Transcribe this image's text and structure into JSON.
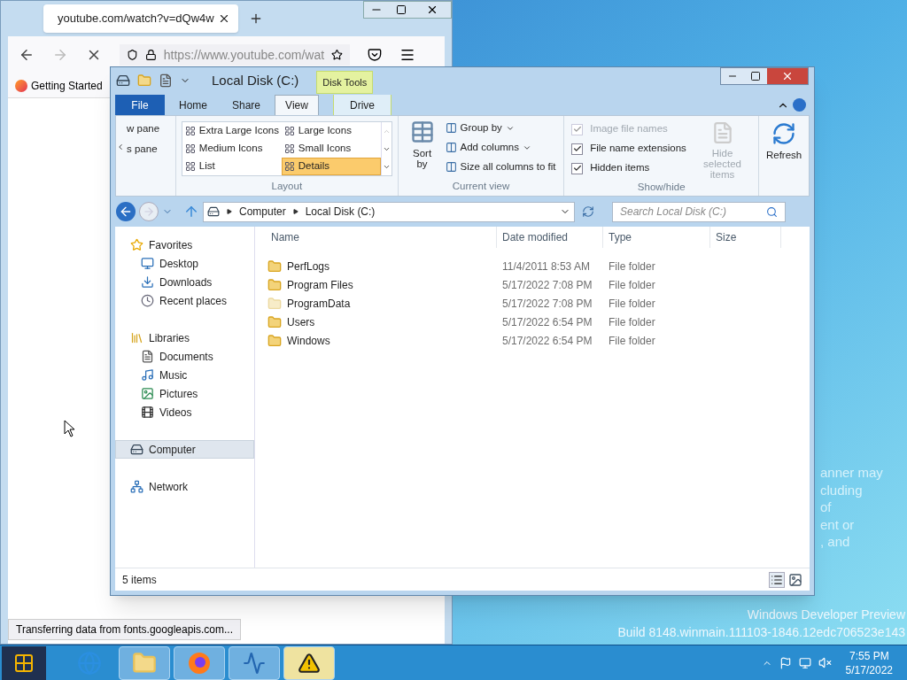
{
  "browser": {
    "tab_title": "youtube.com/watch?v=dQw4w",
    "url": "https://www.youtube.com/wat",
    "bookmark": "Getting Started",
    "status": "Transferring data from fonts.googleapis.com..."
  },
  "explorer": {
    "title": "Local Disk (C:)",
    "context_tab": "Disk Tools",
    "tabs": [
      {
        "label": "File",
        "kind": "file",
        "selected": false
      },
      {
        "label": "Home",
        "kind": "normal",
        "selected": false
      },
      {
        "label": "Share",
        "kind": "normal",
        "selected": false
      },
      {
        "label": "View",
        "kind": "normal",
        "selected": true
      },
      {
        "label": "Drive",
        "kind": "context",
        "selected": false
      }
    ],
    "panes": [
      "w pane",
      "s pane"
    ],
    "layout_options": [
      {
        "label": "Extra Large Icons",
        "selected": false
      },
      {
        "label": "Large Icons",
        "selected": false
      },
      {
        "label": "Medium Icons",
        "selected": false
      },
      {
        "label": "Small Icons",
        "selected": false
      },
      {
        "label": "List",
        "selected": false
      },
      {
        "label": "Details",
        "selected": true
      }
    ],
    "groups": [
      "Layout",
      "Current view",
      "Show/hide"
    ],
    "sort_by": "Sort by",
    "current_view": [
      {
        "label": "Group by",
        "dropdown": true
      },
      {
        "label": "Add columns",
        "dropdown": true
      },
      {
        "label": "Size all columns to fit",
        "dropdown": false
      }
    ],
    "show_hide": [
      {
        "label": "Image file names",
        "checked": true,
        "disabled": true
      },
      {
        "label": "File name extensions",
        "checked": true,
        "disabled": false
      },
      {
        "label": "Hidden items",
        "checked": true,
        "disabled": false
      }
    ],
    "hide_selected": {
      "label": "Hide selected items",
      "disabled": true
    },
    "refresh": "Refresh",
    "breadcrumbs": [
      "Computer",
      "Local Disk (C:)"
    ],
    "search": {
      "placeholder": "Search Local Disk (C:)"
    },
    "nav": [
      {
        "label": "Favorites",
        "kind": "favorites",
        "selected": false,
        "children": [
          {
            "label": "Desktop",
            "kind": "desktop",
            "selected": false
          },
          {
            "label": "Downloads",
            "kind": "downloads",
            "selected": false
          },
          {
            "label": "Recent places",
            "kind": "recent",
            "selected": false
          }
        ]
      },
      {
        "label": "Libraries",
        "kind": "libraries",
        "selected": false,
        "children": [
          {
            "label": "Documents",
            "kind": "documents",
            "selected": false
          },
          {
            "label": "Music",
            "kind": "music",
            "selected": false
          },
          {
            "label": "Pictures",
            "kind": "pictures",
            "selected": false
          },
          {
            "label": "Videos",
            "kind": "videos",
            "selected": false
          }
        ]
      },
      {
        "label": "Computer",
        "kind": "computer",
        "selected": true
      },
      {
        "label": "Network",
        "kind": "network",
        "selected": false
      }
    ],
    "columns": [
      "Name",
      "Date modified",
      "Type",
      "Size"
    ],
    "rows": [
      {
        "name": "PerfLogs",
        "date": "11/4/2011 8:53 AM",
        "type": "File folder",
        "hidden": false
      },
      {
        "name": "Program Files",
        "date": "5/17/2022 7:08 PM",
        "type": "File folder",
        "hidden": false
      },
      {
        "name": "ProgramData",
        "date": "5/17/2022 7:08 PM",
        "type": "File folder",
        "hidden": true
      },
      {
        "name": "Users",
        "date": "5/17/2022 6:54 PM",
        "type": "File folder",
        "hidden": false
      },
      {
        "name": "Windows",
        "date": "5/17/2022 6:54 PM",
        "type": "File folder",
        "hidden": false
      }
    ],
    "status": "5 items"
  },
  "desktop": {
    "notice": [
      "anner may",
      "cluding",
      "of",
      "ent or",
      ", and"
    ],
    "edition": "Windows Developer Preview",
    "build": "Build 8148.winmain.111103-1846.12edc706523e143"
  },
  "taskbar": {
    "apps": [
      {
        "kind": "ie",
        "running": false,
        "flashing": false
      },
      {
        "kind": "explorer",
        "running": true,
        "flashing": false
      },
      {
        "kind": "firefox",
        "running": true,
        "flashing": false
      },
      {
        "kind": "monitor",
        "running": true,
        "flashing": false
      },
      {
        "kind": "warning",
        "running": true,
        "flashing": true
      }
    ],
    "time": "7:55 PM",
    "date": "5/17/2022"
  }
}
